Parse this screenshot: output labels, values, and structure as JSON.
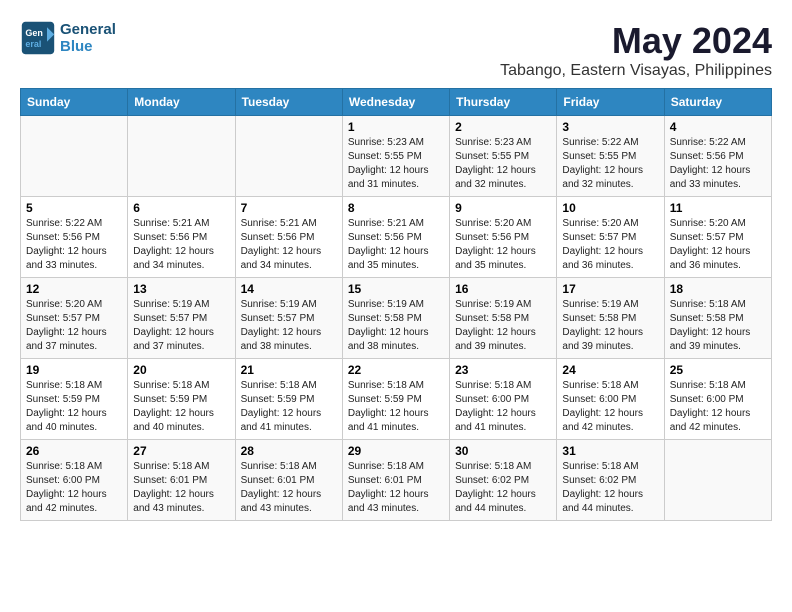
{
  "header": {
    "logo_line1": "General",
    "logo_line2": "Blue",
    "month": "May 2024",
    "location": "Tabango, Eastern Visayas, Philippines"
  },
  "days_of_week": [
    "Sunday",
    "Monday",
    "Tuesday",
    "Wednesday",
    "Thursday",
    "Friday",
    "Saturday"
  ],
  "weeks": [
    [
      {
        "day": "",
        "info": ""
      },
      {
        "day": "",
        "info": ""
      },
      {
        "day": "",
        "info": ""
      },
      {
        "day": "1",
        "info": "Sunrise: 5:23 AM\nSunset: 5:55 PM\nDaylight: 12 hours\nand 31 minutes."
      },
      {
        "day": "2",
        "info": "Sunrise: 5:23 AM\nSunset: 5:55 PM\nDaylight: 12 hours\nand 32 minutes."
      },
      {
        "day": "3",
        "info": "Sunrise: 5:22 AM\nSunset: 5:55 PM\nDaylight: 12 hours\nand 32 minutes."
      },
      {
        "day": "4",
        "info": "Sunrise: 5:22 AM\nSunset: 5:56 PM\nDaylight: 12 hours\nand 33 minutes."
      }
    ],
    [
      {
        "day": "5",
        "info": "Sunrise: 5:22 AM\nSunset: 5:56 PM\nDaylight: 12 hours\nand 33 minutes."
      },
      {
        "day": "6",
        "info": "Sunrise: 5:21 AM\nSunset: 5:56 PM\nDaylight: 12 hours\nand 34 minutes."
      },
      {
        "day": "7",
        "info": "Sunrise: 5:21 AM\nSunset: 5:56 PM\nDaylight: 12 hours\nand 34 minutes."
      },
      {
        "day": "8",
        "info": "Sunrise: 5:21 AM\nSunset: 5:56 PM\nDaylight: 12 hours\nand 35 minutes."
      },
      {
        "day": "9",
        "info": "Sunrise: 5:20 AM\nSunset: 5:56 PM\nDaylight: 12 hours\nand 35 minutes."
      },
      {
        "day": "10",
        "info": "Sunrise: 5:20 AM\nSunset: 5:57 PM\nDaylight: 12 hours\nand 36 minutes."
      },
      {
        "day": "11",
        "info": "Sunrise: 5:20 AM\nSunset: 5:57 PM\nDaylight: 12 hours\nand 36 minutes."
      }
    ],
    [
      {
        "day": "12",
        "info": "Sunrise: 5:20 AM\nSunset: 5:57 PM\nDaylight: 12 hours\nand 37 minutes."
      },
      {
        "day": "13",
        "info": "Sunrise: 5:19 AM\nSunset: 5:57 PM\nDaylight: 12 hours\nand 37 minutes."
      },
      {
        "day": "14",
        "info": "Sunrise: 5:19 AM\nSunset: 5:57 PM\nDaylight: 12 hours\nand 38 minutes."
      },
      {
        "day": "15",
        "info": "Sunrise: 5:19 AM\nSunset: 5:58 PM\nDaylight: 12 hours\nand 38 minutes."
      },
      {
        "day": "16",
        "info": "Sunrise: 5:19 AM\nSunset: 5:58 PM\nDaylight: 12 hours\nand 39 minutes."
      },
      {
        "day": "17",
        "info": "Sunrise: 5:19 AM\nSunset: 5:58 PM\nDaylight: 12 hours\nand 39 minutes."
      },
      {
        "day": "18",
        "info": "Sunrise: 5:18 AM\nSunset: 5:58 PM\nDaylight: 12 hours\nand 39 minutes."
      }
    ],
    [
      {
        "day": "19",
        "info": "Sunrise: 5:18 AM\nSunset: 5:59 PM\nDaylight: 12 hours\nand 40 minutes."
      },
      {
        "day": "20",
        "info": "Sunrise: 5:18 AM\nSunset: 5:59 PM\nDaylight: 12 hours\nand 40 minutes."
      },
      {
        "day": "21",
        "info": "Sunrise: 5:18 AM\nSunset: 5:59 PM\nDaylight: 12 hours\nand 41 minutes."
      },
      {
        "day": "22",
        "info": "Sunrise: 5:18 AM\nSunset: 5:59 PM\nDaylight: 12 hours\nand 41 minutes."
      },
      {
        "day": "23",
        "info": "Sunrise: 5:18 AM\nSunset: 6:00 PM\nDaylight: 12 hours\nand 41 minutes."
      },
      {
        "day": "24",
        "info": "Sunrise: 5:18 AM\nSunset: 6:00 PM\nDaylight: 12 hours\nand 42 minutes."
      },
      {
        "day": "25",
        "info": "Sunrise: 5:18 AM\nSunset: 6:00 PM\nDaylight: 12 hours\nand 42 minutes."
      }
    ],
    [
      {
        "day": "26",
        "info": "Sunrise: 5:18 AM\nSunset: 6:00 PM\nDaylight: 12 hours\nand 42 minutes."
      },
      {
        "day": "27",
        "info": "Sunrise: 5:18 AM\nSunset: 6:01 PM\nDaylight: 12 hours\nand 43 minutes."
      },
      {
        "day": "28",
        "info": "Sunrise: 5:18 AM\nSunset: 6:01 PM\nDaylight: 12 hours\nand 43 minutes."
      },
      {
        "day": "29",
        "info": "Sunrise: 5:18 AM\nSunset: 6:01 PM\nDaylight: 12 hours\nand 43 minutes."
      },
      {
        "day": "30",
        "info": "Sunrise: 5:18 AM\nSunset: 6:02 PM\nDaylight: 12 hours\nand 44 minutes."
      },
      {
        "day": "31",
        "info": "Sunrise: 5:18 AM\nSunset: 6:02 PM\nDaylight: 12 hours\nand 44 minutes."
      },
      {
        "day": "",
        "info": ""
      }
    ]
  ]
}
